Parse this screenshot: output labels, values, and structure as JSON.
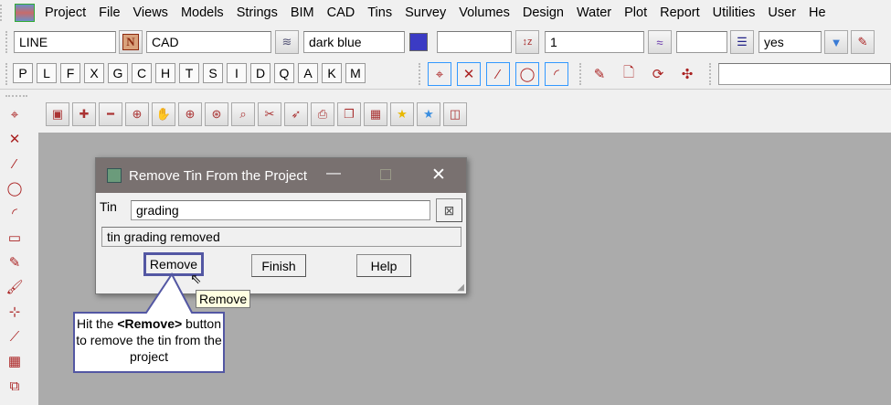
{
  "menu": [
    "Project",
    "File",
    "Views",
    "Models",
    "Strings",
    "BIM",
    "CAD",
    "Tins",
    "Survey",
    "Volumes",
    "Design",
    "Water",
    "Plot",
    "Report",
    "Utilities",
    "User",
    "He"
  ],
  "toolbar1": {
    "string_name": "LINE",
    "model": "CAD",
    "colour": "dark blue",
    "colour_hex": "#3b3bc4",
    "height": "",
    "z_value": "1",
    "linestyle": "",
    "visible": "yes"
  },
  "mode_buttons": [
    "P",
    "L",
    "F",
    "X",
    "G",
    "C",
    "H",
    "T",
    "S",
    "I",
    "D",
    "Q",
    "A",
    "K",
    "M"
  ],
  "dialog": {
    "title": "Remove Tin From the Project",
    "tin_label": "Tin",
    "tin_value": "grading",
    "status": "tin grading removed",
    "remove": "Remove",
    "finish": "Finish",
    "help": "Help",
    "tooltip": "Remove"
  },
  "callout": {
    "pre": "Hit the ",
    "bold": "<Remove>",
    "post": " button to remove the tin from the project"
  }
}
